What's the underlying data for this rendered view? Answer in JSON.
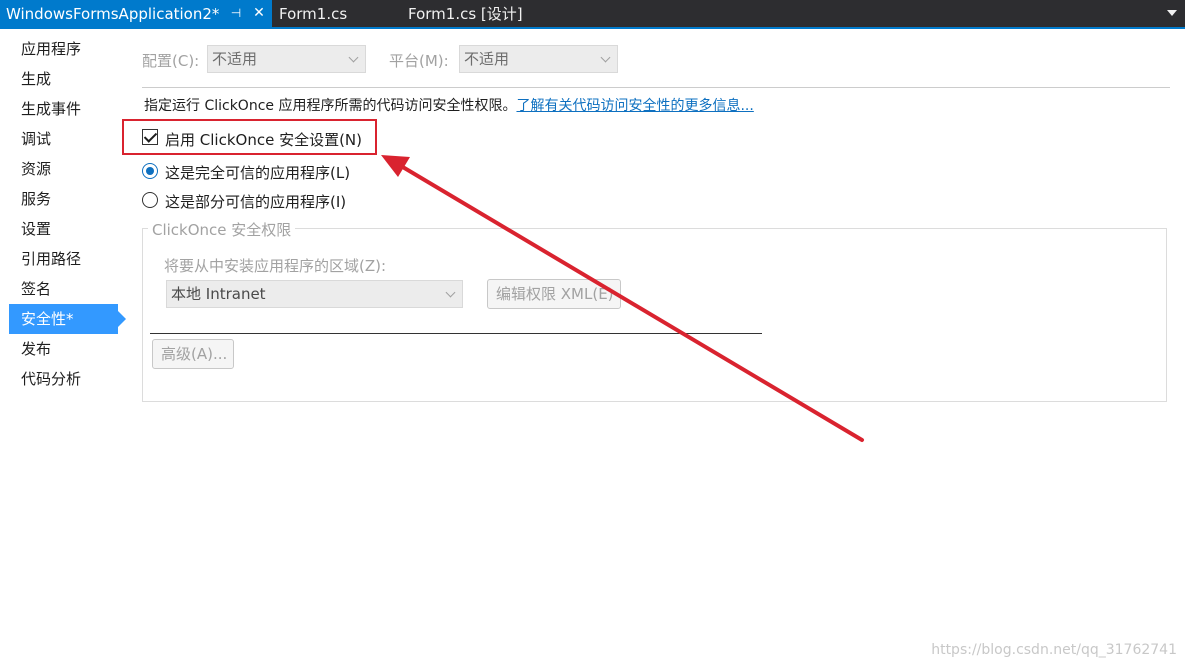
{
  "tabs": [
    {
      "label": "WindowsFormsApplication2*",
      "active": true
    },
    {
      "label": "Form1.cs",
      "active": false
    },
    {
      "label": "Form1.cs [设计]",
      "active": false
    }
  ],
  "tab_icons": {
    "pin": "pin-icon",
    "close": "close-icon",
    "overflow": "chevron-down-icon"
  },
  "nav": {
    "items": [
      "应用程序",
      "生成",
      "生成事件",
      "调试",
      "资源",
      "服务",
      "设置",
      "引用路径",
      "签名",
      "安全性*",
      "发布",
      "代码分析"
    ],
    "selected": "安全性*"
  },
  "config": {
    "config_label": "配置(C):",
    "config_value": "不适用",
    "platform_label": "平台(M):",
    "platform_value": "不适用"
  },
  "description": {
    "text": "指定运行 ClickOnce 应用程序所需的代码访问安全性权限。",
    "link": "了解有关代码访问安全性的更多信息..."
  },
  "security": {
    "enable_label": "启用 ClickOnce 安全设置(N)",
    "enable_checked": true,
    "full_trust_label": "这是完全可信的应用程序(L)",
    "partial_trust_label": "这是部分可信的应用程序(I)",
    "selected": "full"
  },
  "permissions": {
    "group_title": "ClickOnce 安全权限",
    "zone_label": "将要从中安装应用程序的区域(Z):",
    "zone_value": "本地 Intranet",
    "edit_button": "编辑权限 XML(E)",
    "advanced_button": "高级(A)..."
  },
  "colors": {
    "accent": "#007acc",
    "selection": "#3399ff",
    "annotation": "#d9232f",
    "link": "#0e70c0"
  },
  "watermark": "https://blog.csdn.net/qq_31762741"
}
